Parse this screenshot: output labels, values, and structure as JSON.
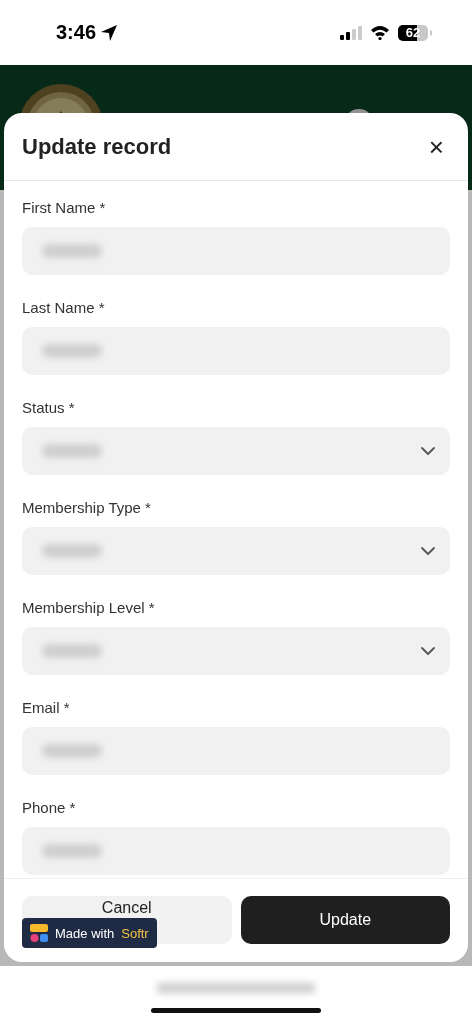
{
  "status_bar": {
    "time": "3:46",
    "battery": "62"
  },
  "modal": {
    "title": "Update record",
    "close": "×",
    "fields": [
      {
        "label": "First Name *",
        "kind": "text",
        "blurred": true
      },
      {
        "label": "Last Name *",
        "kind": "text",
        "blurred": true
      },
      {
        "label": "Status *",
        "kind": "select",
        "blurred": true
      },
      {
        "label": "Membership Type *",
        "kind": "select",
        "blurred": true
      },
      {
        "label": "Membership Level *",
        "kind": "select",
        "blurred": true
      },
      {
        "label": "Email *",
        "kind": "text",
        "blurred": true
      },
      {
        "label": "Phone *",
        "kind": "text",
        "blurred": true
      }
    ],
    "buttons": [
      {
        "label": "Cancel",
        "kind": "secondary"
      },
      {
        "label": "Update",
        "kind": "primary"
      }
    ]
  },
  "badge": {
    "text": "Made with",
    "brand": "Softr"
  },
  "footer": {
    "blurred": true
  }
}
